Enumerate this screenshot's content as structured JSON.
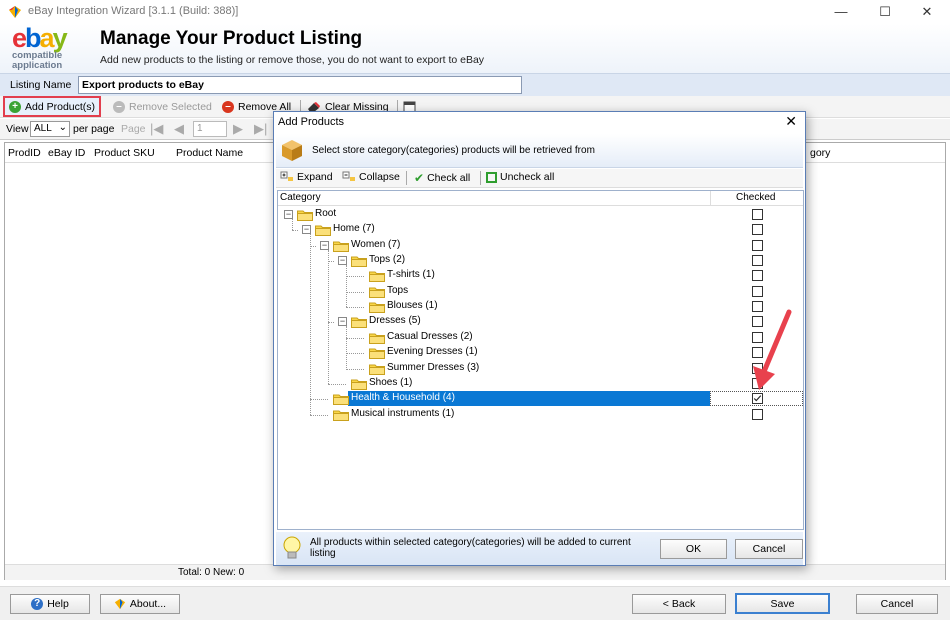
{
  "window": {
    "title": "eBay Integration Wizard [3.1.1 (Build: 388)]",
    "minimize": "—",
    "maximize": "☐",
    "close": "✕"
  },
  "header": {
    "logo_letters": [
      "e",
      "b",
      "a",
      "y"
    ],
    "logo_sub1": "compatible",
    "logo_sub2": "application",
    "title": "Manage Your Product Listing",
    "subtitle": "Add new products to the listing or remove those, you do not want to export to eBay"
  },
  "listing": {
    "label": "Listing Name",
    "value": "Export products to eBay"
  },
  "toolbar": {
    "add": "Add Product(s)",
    "remove_selected": "Remove Selected",
    "remove_all": "Remove All",
    "clear_missing": "Clear Missing"
  },
  "pager": {
    "view": "View",
    "per_page_value": "ALL",
    "per_page": "per page",
    "page": "Page",
    "page_value": "1"
  },
  "grid": {
    "columns": [
      "ProdID",
      "eBay ID",
      "Product SKU",
      "Product Name",
      "Category"
    ],
    "category_partial": "gory",
    "footer": "Total: 0 New: 0"
  },
  "bottom": {
    "help": "Help",
    "about": "About...",
    "back": "< Back",
    "save": "Save",
    "cancel": "Cancel"
  },
  "dialog": {
    "title": "Add Products",
    "close": "✕",
    "header_text": "Select store category(categories) products will be retrieved from",
    "tools": {
      "expand": "Expand",
      "collapse": "Collapse",
      "check_all": "Check all",
      "uncheck_all": "Uncheck all"
    },
    "columns": {
      "category": "Category",
      "checked": "Checked"
    },
    "tree": [
      {
        "label": "Root",
        "level": 0,
        "expander": "⊟",
        "checked": false
      },
      {
        "label": "Home (7)",
        "level": 1,
        "expander": "⊟",
        "checked": false
      },
      {
        "label": "Women (7)",
        "level": 2,
        "expander": "⊟",
        "checked": false
      },
      {
        "label": "Tops (2)",
        "level": 3,
        "expander": "⊟",
        "checked": false
      },
      {
        "label": "T-shirts (1)",
        "level": 4,
        "expander": "",
        "checked": false
      },
      {
        "label": "Tops",
        "level": 4,
        "expander": "",
        "checked": false
      },
      {
        "label": "Blouses (1)",
        "level": 4,
        "expander": "",
        "checked": false
      },
      {
        "label": "Dresses (5)",
        "level": 3,
        "expander": "⊟",
        "checked": false
      },
      {
        "label": "Casual Dresses (2)",
        "level": 4,
        "expander": "",
        "checked": false
      },
      {
        "label": "Evening Dresses (1)",
        "level": 4,
        "expander": "",
        "checked": false
      },
      {
        "label": "Summer Dresses (3)",
        "level": 4,
        "expander": "",
        "checked": false
      },
      {
        "label": "Shoes (1)",
        "level": 3,
        "expander": "",
        "checked": false
      },
      {
        "label": "Health & Household (4)",
        "level": 2,
        "expander": "",
        "checked": true,
        "selected": true
      },
      {
        "label": "Musical instruments (1)",
        "level": 2,
        "expander": "",
        "checked": false
      }
    ],
    "footer_text": "All products within selected category(categories) will be added to current listing",
    "ok": "OK",
    "cancel": "Cancel"
  },
  "colors": {
    "selection": "#0a78d4",
    "highlight_border": "#e23e4d",
    "arrow": "#e8414d"
  }
}
